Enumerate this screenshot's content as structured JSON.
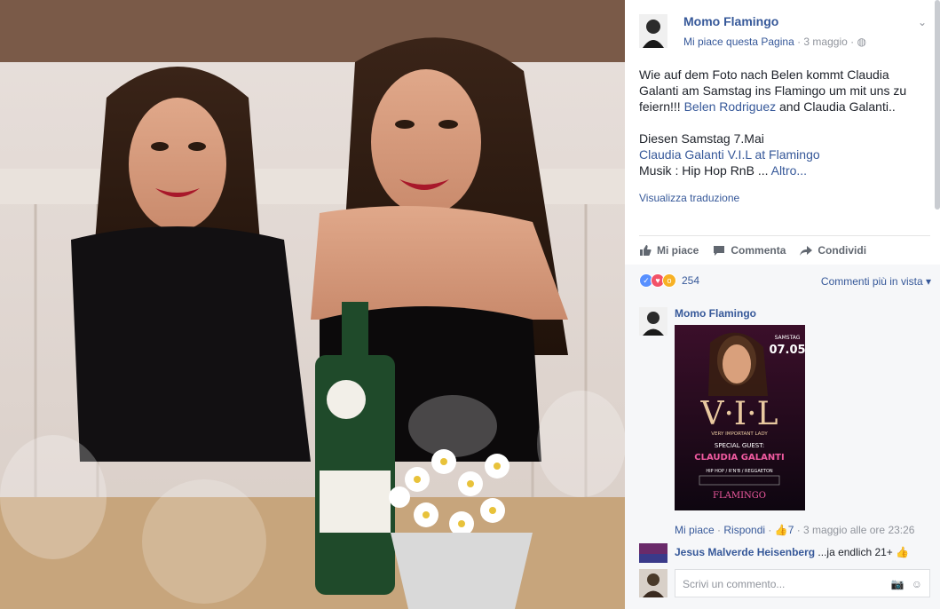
{
  "post": {
    "author": "Momo Flamingo",
    "like_page": "Mi piace questa Pagina",
    "sep": " · ",
    "date": "3 maggio",
    "globe": " · ◍",
    "text_line1": "Wie auf dem Foto nach Belen kommt Claudia Galanti am Samstag ins Flamingo um mit uns zu feiern!!! ",
    "mention": "Belen Rodriguez",
    "text_line1_end": " and Claudia Galanti..",
    "text_line2": "Diesen Samstag 7.Mai",
    "event_link": "Claudia Galanti V.I.L at Flamingo",
    "text_line3": "Musik : Hip Hop RnB ... ",
    "more": "Altro...",
    "translate": "Visualizza traduzione"
  },
  "actions": {
    "like": "Mi piace",
    "comment": "Commenta",
    "share": "Condividi"
  },
  "reactions": {
    "count": "254",
    "sort": "Commenti più in vista"
  },
  "comment1": {
    "author": "Momo Flamingo",
    "flyer": {
      "day": "SAMSTAG",
      "date": "07.05",
      "title": "V·I·L",
      "subtitle": "VERY IMPORTANT LADY",
      "special": "SPECIAL GUEST:",
      "guest": "CLAUDIA GALANTI",
      "genres": "HIP HOP / R'N'B / REGGAETON",
      "venue": "FLAMINGO"
    },
    "like": "Mi piace",
    "reply": "Rispondi",
    "likes": "7",
    "time": "3 maggio alle ore 23:26"
  },
  "comment2": {
    "author": "Jesus Malverde Heisenberg",
    "text": " ...ja endlich 21+"
  },
  "write": {
    "placeholder": "Scrivi un commento..."
  },
  "colors": {
    "link": "#365899",
    "muted": "#90949c"
  }
}
